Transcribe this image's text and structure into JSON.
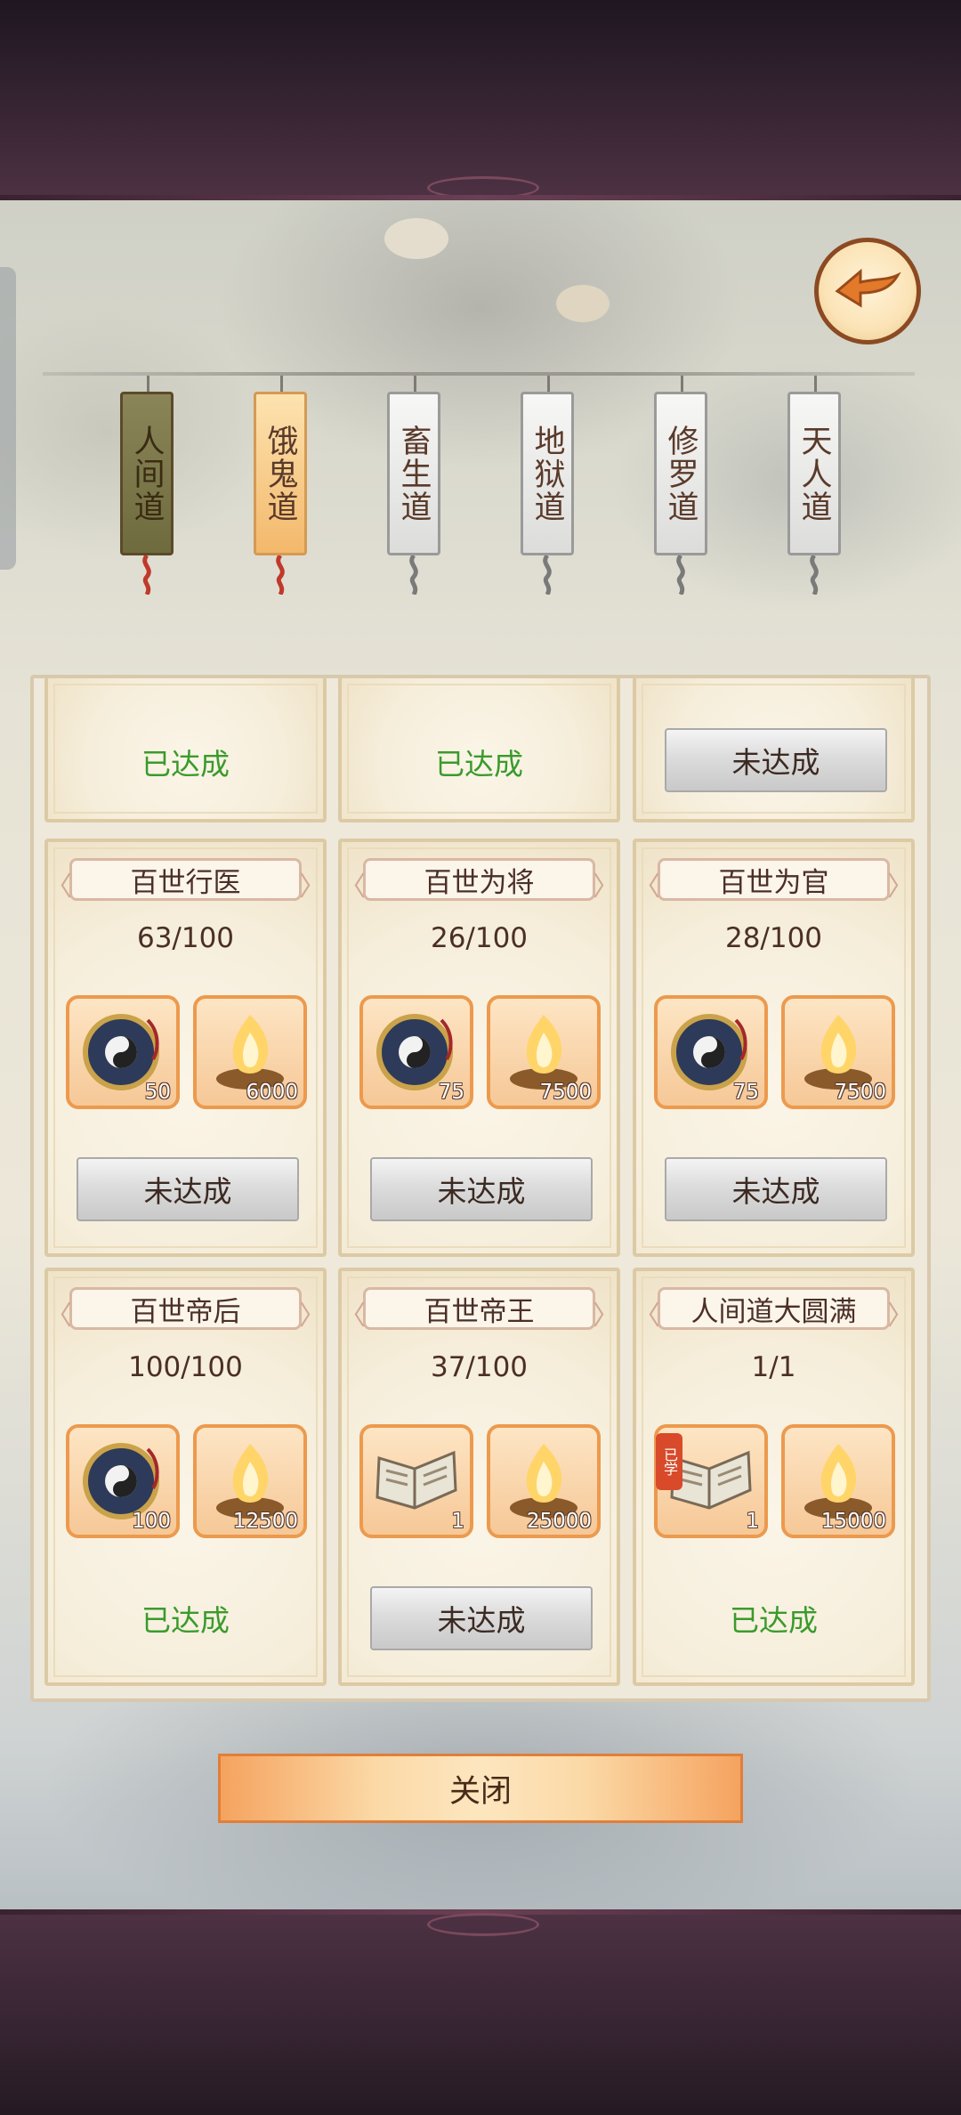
{
  "tabs": [
    {
      "label": "人间道",
      "state": "active"
    },
    {
      "label": "饿鬼道",
      "state": "highlight"
    },
    {
      "label": "畜生道",
      "state": "normal"
    },
    {
      "label": "地狱道",
      "state": "normal"
    },
    {
      "label": "修罗道",
      "state": "normal"
    },
    {
      "label": "天人道",
      "state": "normal"
    }
  ],
  "partial_row": [
    {
      "status": "已达成"
    },
    {
      "status": "已达成"
    },
    {
      "status": "未达成"
    }
  ],
  "cards": [
    {
      "title": "百世行医",
      "progress": "63/100",
      "rewards": [
        {
          "icon": "bagua-compass-icon",
          "count": "50"
        },
        {
          "icon": "flame-cauldron-icon",
          "count": "6000"
        }
      ],
      "status": "未达成"
    },
    {
      "title": "百世为将",
      "progress": "26/100",
      "rewards": [
        {
          "icon": "bagua-compass-icon",
          "count": "75"
        },
        {
          "icon": "flame-cauldron-icon",
          "count": "7500"
        }
      ],
      "status": "未达成"
    },
    {
      "title": "百世为官",
      "progress": "28/100",
      "rewards": [
        {
          "icon": "bagua-compass-icon",
          "count": "75"
        },
        {
          "icon": "flame-cauldron-icon",
          "count": "7500"
        }
      ],
      "status": "未达成"
    },
    {
      "title": "百世帝后",
      "progress": "100/100",
      "rewards": [
        {
          "icon": "bagua-compass-icon",
          "count": "100"
        },
        {
          "icon": "flame-cauldron-icon",
          "count": "12500"
        }
      ],
      "status": "已达成"
    },
    {
      "title": "百世帝王",
      "progress": "37/100",
      "rewards": [
        {
          "icon": "skill-book-icon",
          "count": "1"
        },
        {
          "icon": "flame-cauldron-icon",
          "count": "25000"
        }
      ],
      "status": "未达成"
    },
    {
      "title": "人间道大圆满",
      "progress": "1/1",
      "rewards": [
        {
          "icon": "skill-book-icon",
          "count": "1",
          "badge": "已学"
        },
        {
          "icon": "flame-cauldron-icon",
          "count": "15000"
        }
      ],
      "status": "已达成"
    }
  ],
  "close_label": "关闭",
  "colors": {
    "achieved": "#3a9b2c",
    "accent": "#ec9a4e"
  }
}
